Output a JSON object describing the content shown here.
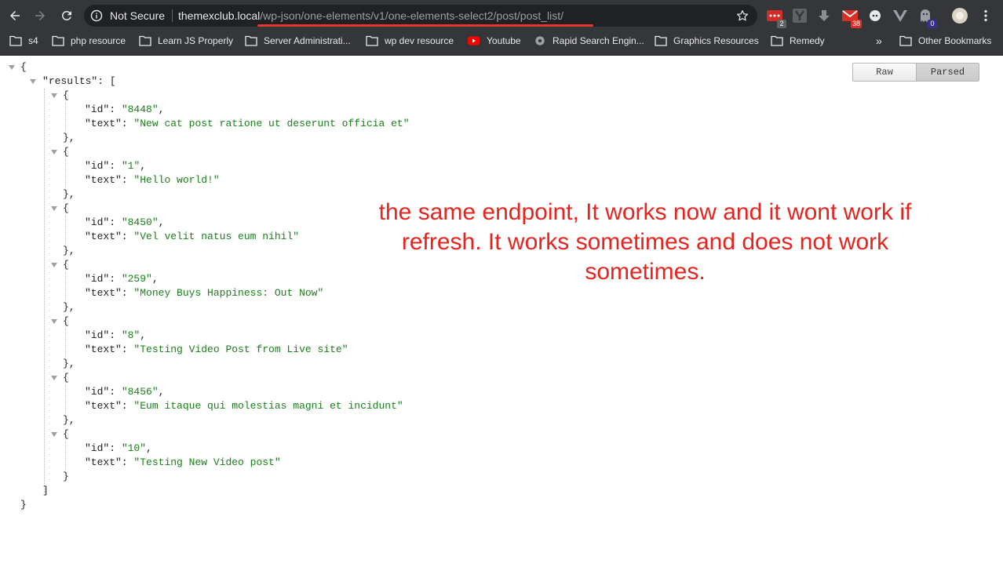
{
  "browser": {
    "security_label": "Not Secure",
    "url_host": "themexclub.local",
    "url_path": "/wp-json/one-elements/v1/one-elements-select2/post/post_list/",
    "extensions": [
      {
        "name": "lastpass-icon",
        "badge": "2",
        "badge_color": "#e23b2e"
      },
      {
        "name": "y-extension-icon",
        "badge": ""
      },
      {
        "name": "download-icon",
        "badge": ""
      },
      {
        "name": "gmail-icon",
        "badge": "38",
        "badge_color": "#e23b2e"
      },
      {
        "name": "circle-extension-icon",
        "badge": ""
      },
      {
        "name": "vue-devtools-icon",
        "badge": ""
      },
      {
        "name": "ghostery-icon",
        "badge": "0",
        "badge_color": "#3b2e8f"
      }
    ]
  },
  "bookmarks": {
    "items": [
      {
        "label": "s4",
        "icon": "folder-icon"
      },
      {
        "label": "php resource",
        "icon": "folder-icon"
      },
      {
        "label": "Learn JS Properly",
        "icon": "folder-icon"
      },
      {
        "label": "Server Administrati...",
        "icon": "folder-icon"
      },
      {
        "label": "wp dev resource",
        "icon": "folder-icon"
      },
      {
        "label": "Youtube",
        "icon": "youtube-icon"
      },
      {
        "label": "Rapid Search Engin...",
        "icon": "gear-icon"
      },
      {
        "label": "Graphics Resources",
        "icon": "folder-icon"
      },
      {
        "label": "Remedy",
        "icon": "folder-icon"
      }
    ],
    "overflow": "»",
    "other": "Other Bookmarks"
  },
  "viewer": {
    "raw_label": "Raw",
    "parsed_label": "Parsed",
    "active": "Parsed"
  },
  "json": {
    "root_key": "results",
    "results": [
      {
        "id": "8448",
        "text": "New cat post ratione ut deserunt officia et"
      },
      {
        "id": "1",
        "text": "Hello world!"
      },
      {
        "id": "8450",
        "text": "Vel velit natus eum nihil"
      },
      {
        "id": "259",
        "text": "Money Buys Happiness: Out Now"
      },
      {
        "id": "8",
        "text": "Testing Video Post from Live site"
      },
      {
        "id": "8456",
        "text": "Eum itaque qui molestias magni et incidunt"
      },
      {
        "id": "10",
        "text": "Testing New Video post"
      }
    ]
  },
  "annotation": {
    "text": "the same endpoint, It works now and it wont work if refresh. It works sometimes and does not work sometimes.",
    "color": "#e8231e"
  }
}
